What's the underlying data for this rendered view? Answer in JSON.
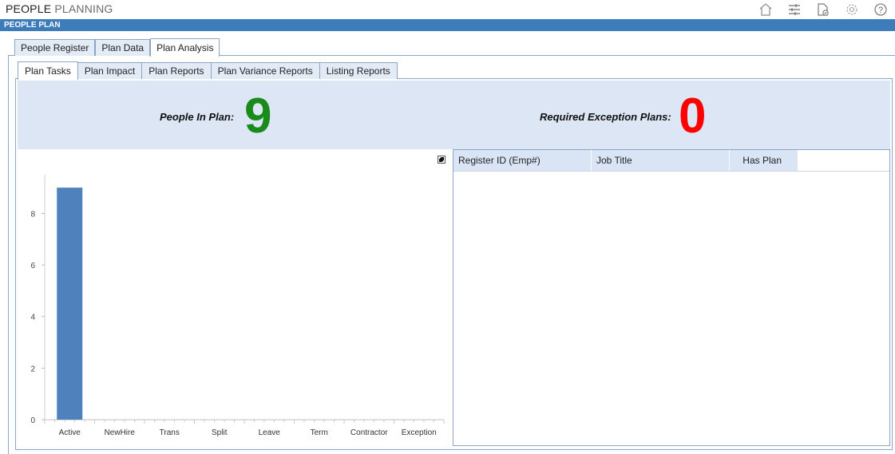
{
  "app": {
    "title_part1": "PEOPLE",
    "title_part2": "PLANNING",
    "section": "PEOPLE PLAN"
  },
  "toolbar_icons": [
    "home-icon",
    "sliders-icon",
    "document-check-icon",
    "gear-icon",
    "help-icon"
  ],
  "outer_tabs": [
    {
      "label": "People Register",
      "active": false
    },
    {
      "label": "Plan Data",
      "active": false
    },
    {
      "label": "Plan Analysis",
      "active": true
    }
  ],
  "inner_tabs": [
    {
      "label": "Plan Tasks",
      "active": true
    },
    {
      "label": "Plan Impact",
      "active": false
    },
    {
      "label": "Plan Reports",
      "active": false
    },
    {
      "label": "Plan Variance Reports",
      "active": false
    },
    {
      "label": "Listing Reports",
      "active": false
    }
  ],
  "summary": {
    "people_label": "People In Plan:",
    "people_value": "9",
    "people_color": "#1a8a1a",
    "exceptions_label": "Required Exception Plans:",
    "exceptions_value": "0",
    "exceptions_color": "#ff0000"
  },
  "chart_data": {
    "type": "bar",
    "categories": [
      "Active",
      "NewHire",
      "Trans",
      "Split",
      "Leave",
      "Term",
      "Contractor",
      "Exception"
    ],
    "values": [
      9,
      0,
      0,
      0,
      0,
      0,
      0,
      0
    ],
    "ylim": [
      0,
      9.5
    ],
    "yticks": [
      0,
      2,
      4,
      6,
      8
    ],
    "bar_color": "#4f81bd",
    "title": "",
    "xlabel": "",
    "ylabel": ""
  },
  "grid": {
    "columns": [
      "Register ID (Emp#)",
      "Job Title",
      "Has Plan"
    ],
    "rows": []
  }
}
